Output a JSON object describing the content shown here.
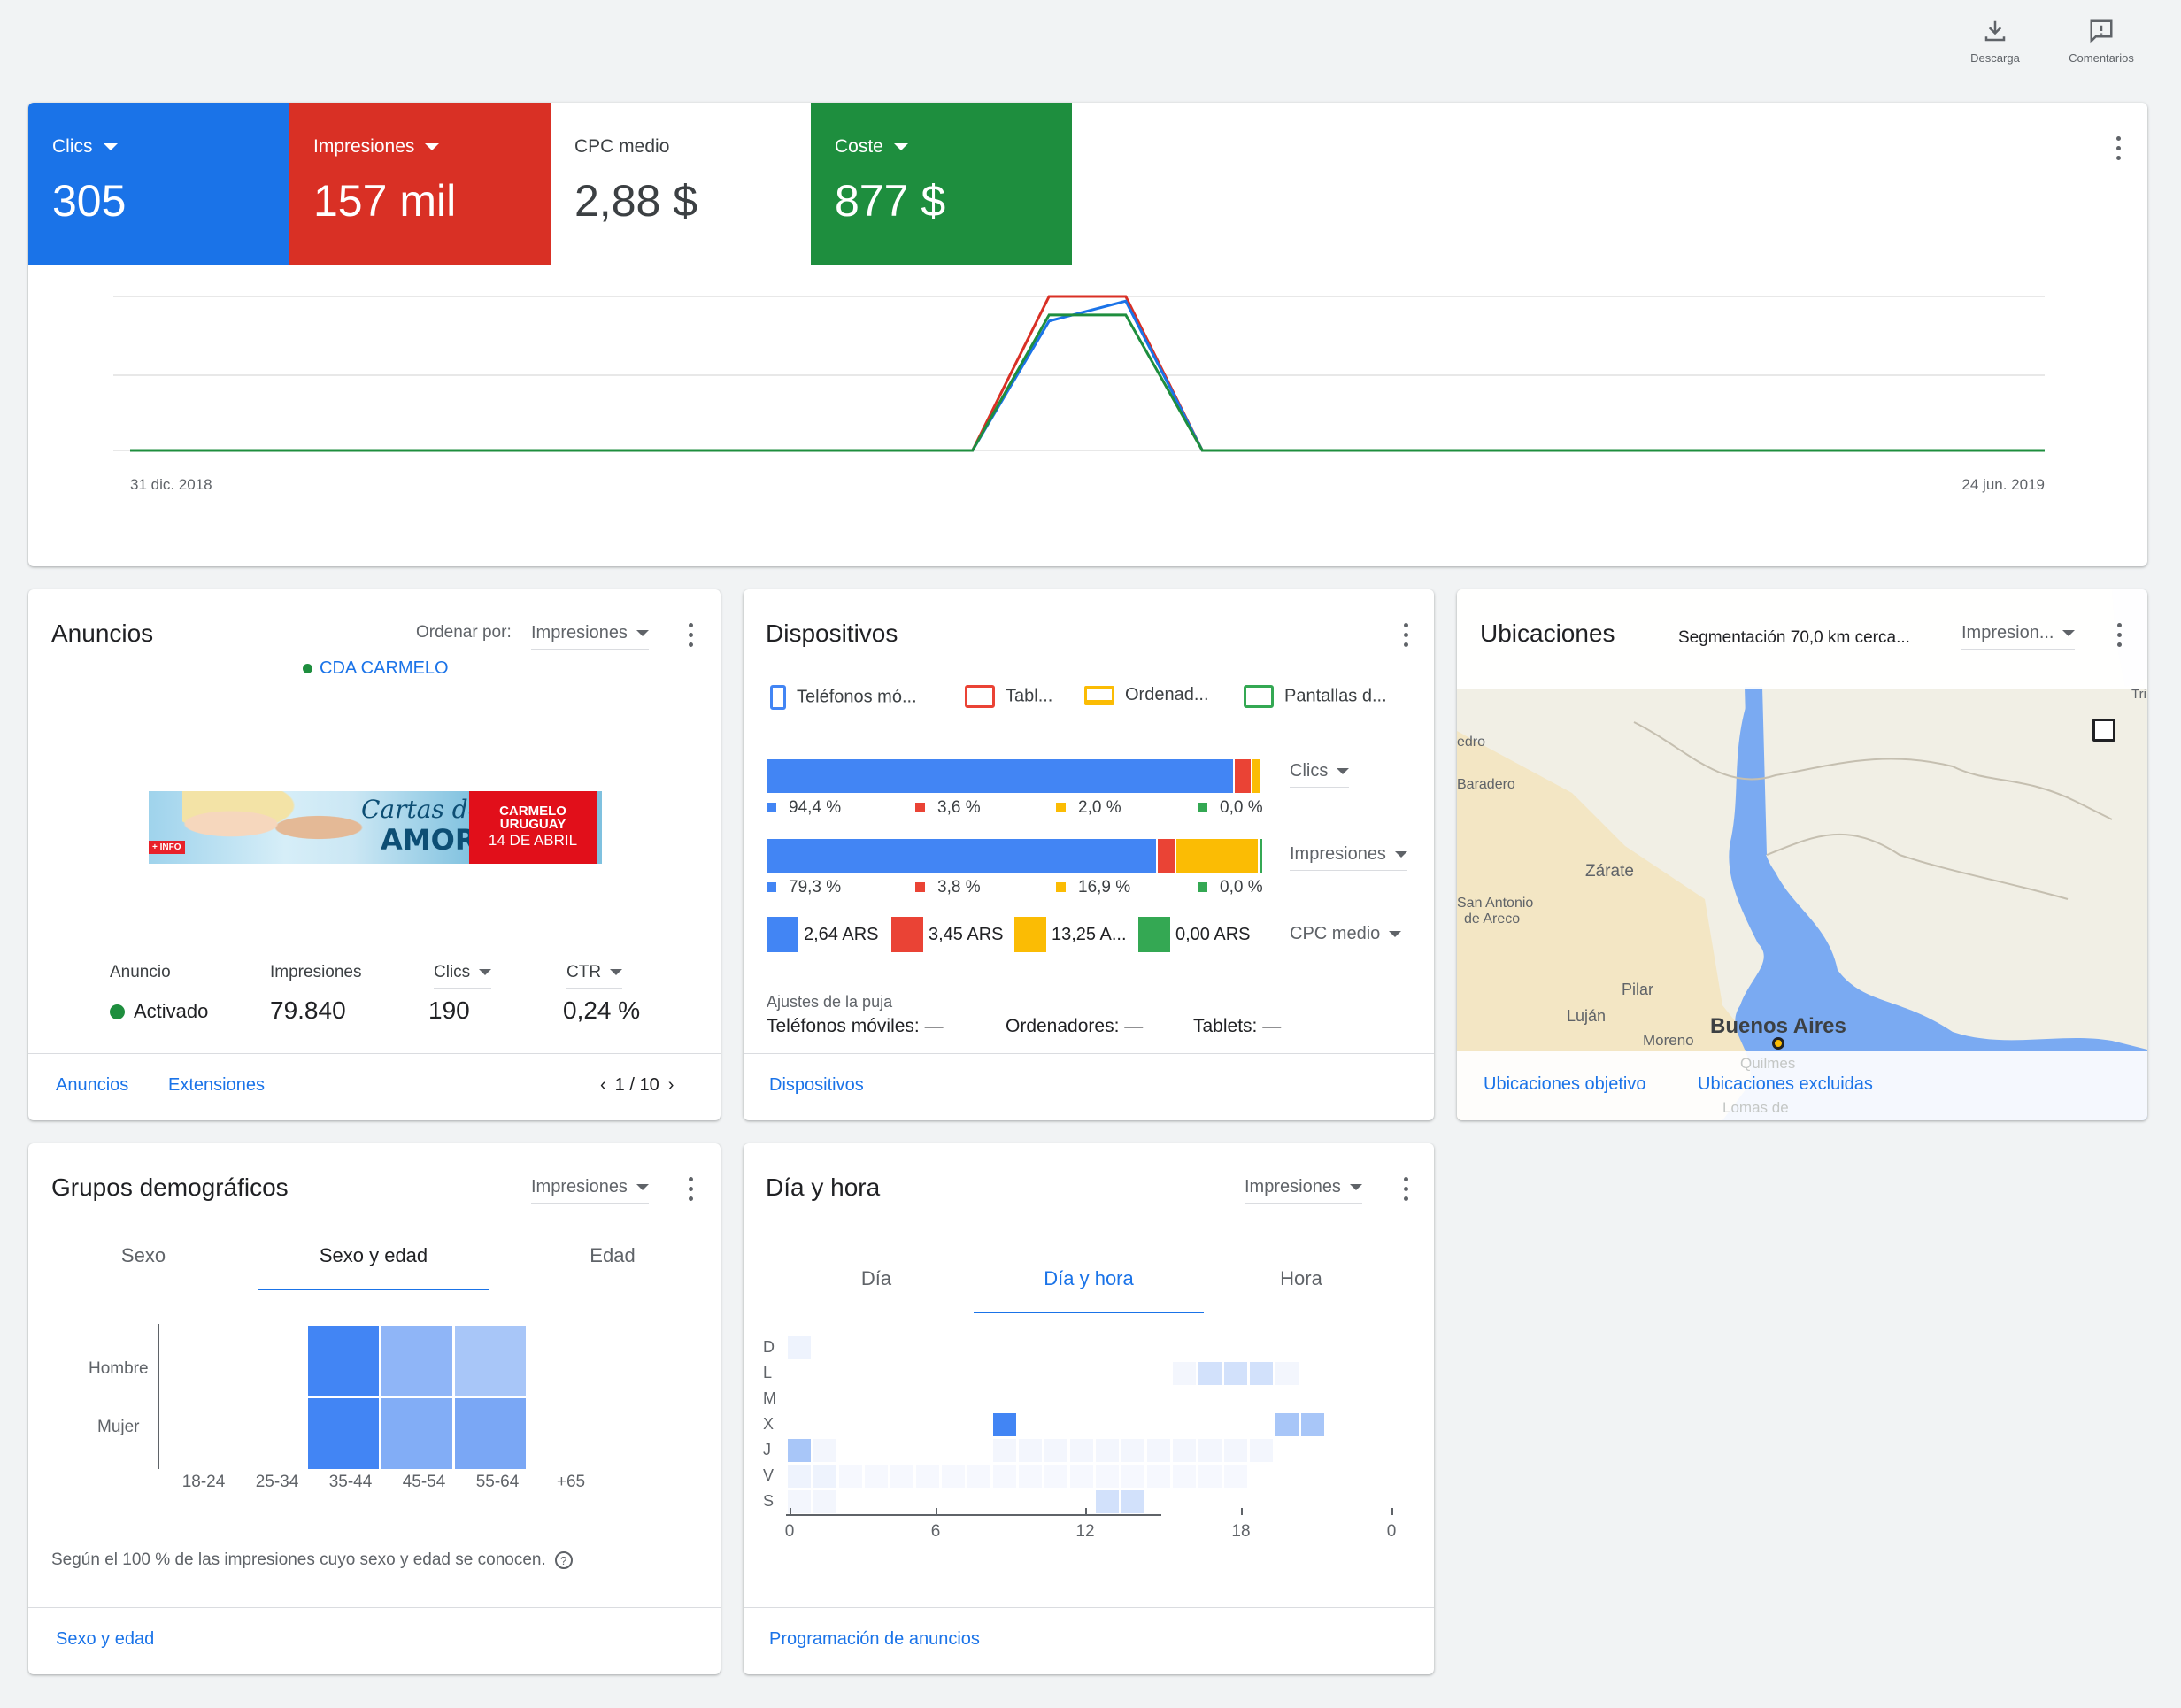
{
  "toolbar": {
    "download": "Descarga",
    "feedback": "Comentarios"
  },
  "metrics": [
    {
      "label": "Clics",
      "value": "305",
      "color": "#1a73e8"
    },
    {
      "label": "Impresiones",
      "value": "157 mil",
      "color": "#d93025"
    },
    {
      "label": "CPC medio",
      "value": "2,88 $",
      "color": "#ffffff"
    },
    {
      "label": "Coste",
      "value": "877 $",
      "color": "#1e8e3e"
    }
  ],
  "chart_data": {
    "type": "line",
    "x_labels": [
      "31 dic. 2018",
      "24 jun. 2019"
    ],
    "series": [
      {
        "color": "#d93025",
        "points": [
          0,
          0,
          0,
          0,
          0,
          0,
          0,
          0,
          0,
          0,
          0,
          0,
          1,
          1,
          0,
          0,
          0,
          0,
          0,
          0,
          0,
          0,
          0,
          0,
          0,
          0
        ]
      },
      {
        "color": "#1a73e8",
        "points": [
          0,
          0,
          0,
          0,
          0,
          0,
          0,
          0,
          0,
          0,
          0,
          0,
          0.84,
          0.97,
          0,
          0,
          0,
          0,
          0,
          0,
          0,
          0,
          0,
          0,
          0,
          0
        ]
      },
      {
        "color": "#1e8e3e",
        "points": [
          0,
          0,
          0,
          0,
          0,
          0,
          0,
          0,
          0,
          0,
          0,
          0,
          0.88,
          0.88,
          0,
          0,
          0,
          0,
          0,
          0,
          0,
          0,
          0,
          0,
          0,
          0
        ]
      }
    ]
  },
  "ads": {
    "title": "Anuncios",
    "sort_label": "Ordenar por:",
    "sort_value": "Impresiones",
    "advertiser": "CDA CARMELO",
    "banner": {
      "line1": "Cartas de",
      "line2": "AMOR",
      "tag": "+ INFO",
      "r1": "CARMELO",
      "r2": "URUGUAY",
      "r3": "14 DE ABRIL"
    },
    "col_headers": [
      "Anuncio",
      "Impresiones",
      "Clics",
      "CTR"
    ],
    "status": "Activado",
    "impressions": "79.840",
    "clicks": "190",
    "ctr": "0,24 %",
    "footer_links": [
      "Anuncios",
      "Extensiones"
    ],
    "pager": "1 / 10"
  },
  "devices": {
    "title": "Dispositivos",
    "legend": [
      "Teléfonos mó...",
      "Tabl...",
      "Ordenad...",
      "Pantallas d..."
    ],
    "rows": [
      {
        "metric": "Clics",
        "shares": [
          94.4,
          3.6,
          2.0,
          0.0
        ],
        "labels": [
          "94,4 %",
          "3,6 %",
          "2,0 %",
          "0,0 %"
        ]
      },
      {
        "metric": "Impresiones",
        "shares": [
          79.3,
          3.8,
          16.9,
          0.9
        ],
        "labels": [
          "79,3 %",
          "3,8 %",
          "16,9 %",
          "0,0 %"
        ]
      }
    ],
    "cpc_metric": "CPC medio",
    "cpc_values": [
      "2,64 ARS",
      "3,45 ARS",
      "13,25 A...",
      "0,00 ARS"
    ],
    "bid_title": "Ajustes de la puja",
    "bid_items": [
      "Teléfonos móviles: —",
      "Ordenadores: —",
      "Tablets: —"
    ],
    "footer_link": "Dispositivos",
    "colors": [
      "#4285f4",
      "#ea4335",
      "#fbbc04",
      "#34a853"
    ]
  },
  "locations": {
    "title": "Ubicaciones",
    "targeting": "Segmentación 70,0 km cerca...",
    "metric": "Impresion...",
    "map_labels": [
      "edro",
      "Baradero",
      "Zárate",
      "San Antonio",
      "de Areco",
      "Pilar",
      "Luján",
      "Moreno",
      "Buenos Aires",
      "Tri",
      "Quilmes",
      "Lomas de"
    ],
    "footer_links": [
      "Ubicaciones objetivo",
      "Ubicaciones excluidas"
    ]
  },
  "demographics": {
    "title": "Grupos demográficos",
    "metric": "Impresiones",
    "tabs": [
      "Sexo",
      "Sexo y edad",
      "Edad"
    ],
    "rows": [
      "Hombre",
      "Mujer"
    ],
    "ages": [
      "18-24",
      "25-34",
      "35-44",
      "45-54",
      "55-64",
      "+65"
    ],
    "note": "Según el 100 % de las impresiones cuyo sexo y edad se conocen.",
    "footer_link": "Sexo y edad"
  },
  "dayhour": {
    "title": "Día y hora",
    "metric": "Impresiones",
    "tabs": [
      "Día",
      "Día y hora",
      "Hora"
    ],
    "days": [
      "D",
      "L",
      "M",
      "X",
      "J",
      "V",
      "S"
    ],
    "hours": [
      "0",
      "6",
      "12",
      "18",
      "0"
    ],
    "footer_link": "Programación de anuncios"
  }
}
